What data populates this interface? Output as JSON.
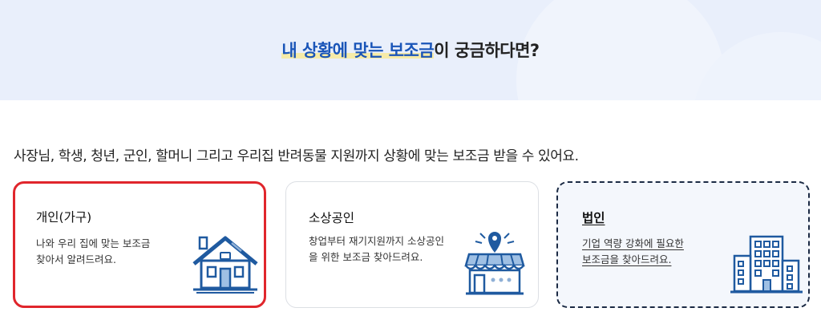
{
  "hero": {
    "highlight": "내 상황에 맞는 보조금",
    "rest": "이 궁금하다면?"
  },
  "intro": "사장님, 학생, 청년, 군인, 할머니 그리고 우리집 반려동물 지원까지 상황에 맞는 보조금 받을 수 있어요.",
  "cards": [
    {
      "title": "개인(가구)",
      "desc_line1": "나와 우리 집에 맞는 보조금",
      "desc_line2": "찾아서 알려드려요.",
      "icon": "house-icon",
      "selected": true
    },
    {
      "title": "소상공인",
      "desc_line1": "창업부터 재기지원까지 소상공인",
      "desc_line2": "을 위한 보조금 찾아드려요.",
      "icon": "storefront-icon",
      "selected": false
    },
    {
      "title": "법인",
      "desc_line1": "기업 역량 강화에 필요한",
      "desc_line2": "보조금을 찾아드려요.",
      "icon": "office-building-icon",
      "selected": false,
      "focused": true
    }
  ],
  "colors": {
    "accent": "#1a55b8",
    "highlight": "#f6eba8",
    "selected_border": "#e0262c",
    "icon_blue": "#1f5aa0"
  }
}
